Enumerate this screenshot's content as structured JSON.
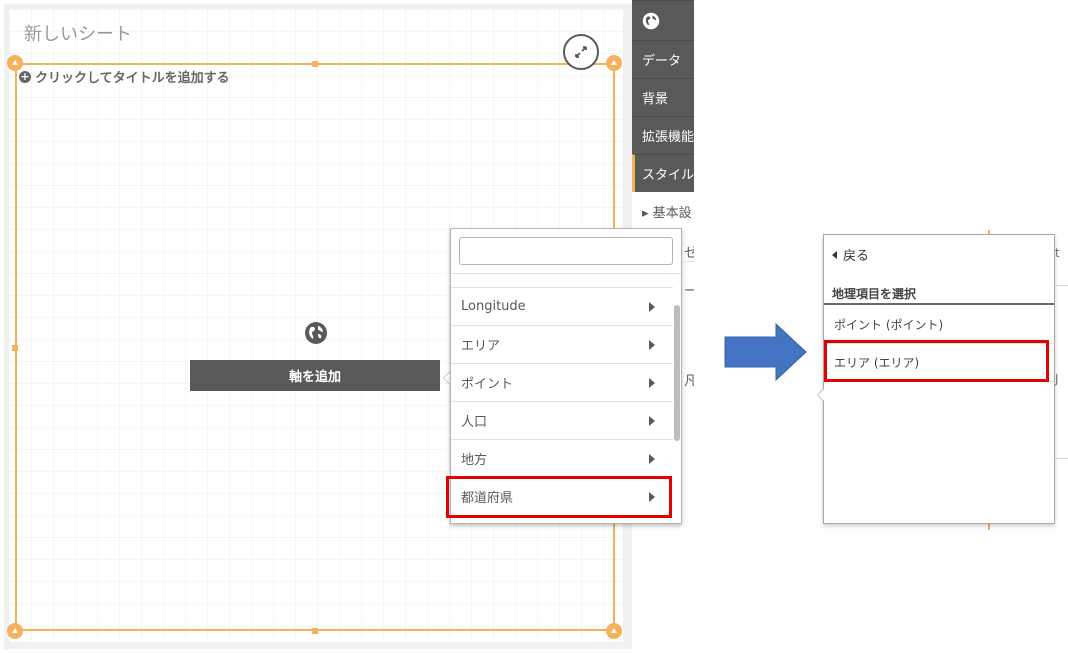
{
  "sheet": {
    "title": "新しいシート",
    "add_title_label": "クリックしてタイトルを追加する",
    "add_axis_button": "軸を追加"
  },
  "side_panel": {
    "items": [
      {
        "label": "データ"
      },
      {
        "label": "背景"
      },
      {
        "label": "拡張機能"
      },
      {
        "label": "スタイル",
        "active": true
      }
    ],
    "sub_items": [
      {
        "label": "▸ 基本設"
      },
      {
        "label": "ゼ"
      },
      {
        "label": "ー"
      },
      {
        "label": "凡"
      }
    ]
  },
  "field_dropdown": {
    "search_placeholder": "",
    "items": [
      {
        "label": "Longitude"
      },
      {
        "label": "エリア"
      },
      {
        "label": "ポイント"
      },
      {
        "label": "人口"
      },
      {
        "label": "地方"
      },
      {
        "label": "都道府県",
        "highlighted": true
      }
    ]
  },
  "geo_popup": {
    "back_label": "戻る",
    "heading": "地理項目を選択",
    "items": [
      {
        "label": "ポイント (ポイント)"
      },
      {
        "label": "エリア (エリア)",
        "highlighted": true
      }
    ]
  },
  "colors": {
    "accent_orange": "#f6b15c",
    "highlight_red": "#e00000",
    "arrow_blue": "#4472c4",
    "panel_dark": "#595959"
  }
}
